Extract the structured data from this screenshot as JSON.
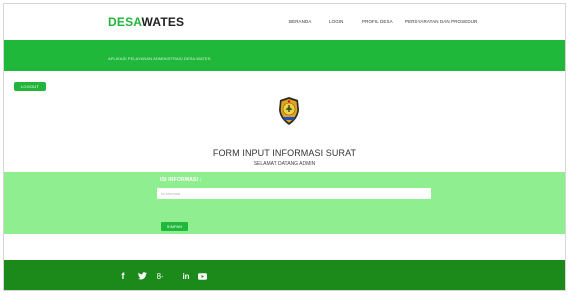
{
  "brand": {
    "part1": "DESA",
    "part2": "WATES"
  },
  "nav": {
    "items": [
      "BERANDA",
      "LOGIN",
      "PROFIL DESA",
      "PERSYARATAN DAN PROSEDUR"
    ]
  },
  "banner": {
    "subtitle": "APLIKASI PELAYANAN ADMINISTRASI DESA WATES"
  },
  "logout_label": "LOGOUT",
  "crest_icon": "village-crest-icon",
  "page": {
    "title": "FORM INPUT INFORMASI SURAT",
    "subtitle": "SELAMAT DATANG ADMIN"
  },
  "form": {
    "label": "ISI INFORMASI :",
    "input_value": "",
    "input_placeholder": "Isi informasi",
    "submit_label": "SIMPAN"
  },
  "footer": {
    "social_icons": [
      "facebook-icon",
      "twitter-icon",
      "google-plus-icon",
      "linkedin-icon",
      "youtube-icon"
    ]
  },
  "colors": {
    "green_primary": "#1fb83a",
    "green_light": "#8fee8f",
    "green_footer": "#1b8a1b"
  }
}
